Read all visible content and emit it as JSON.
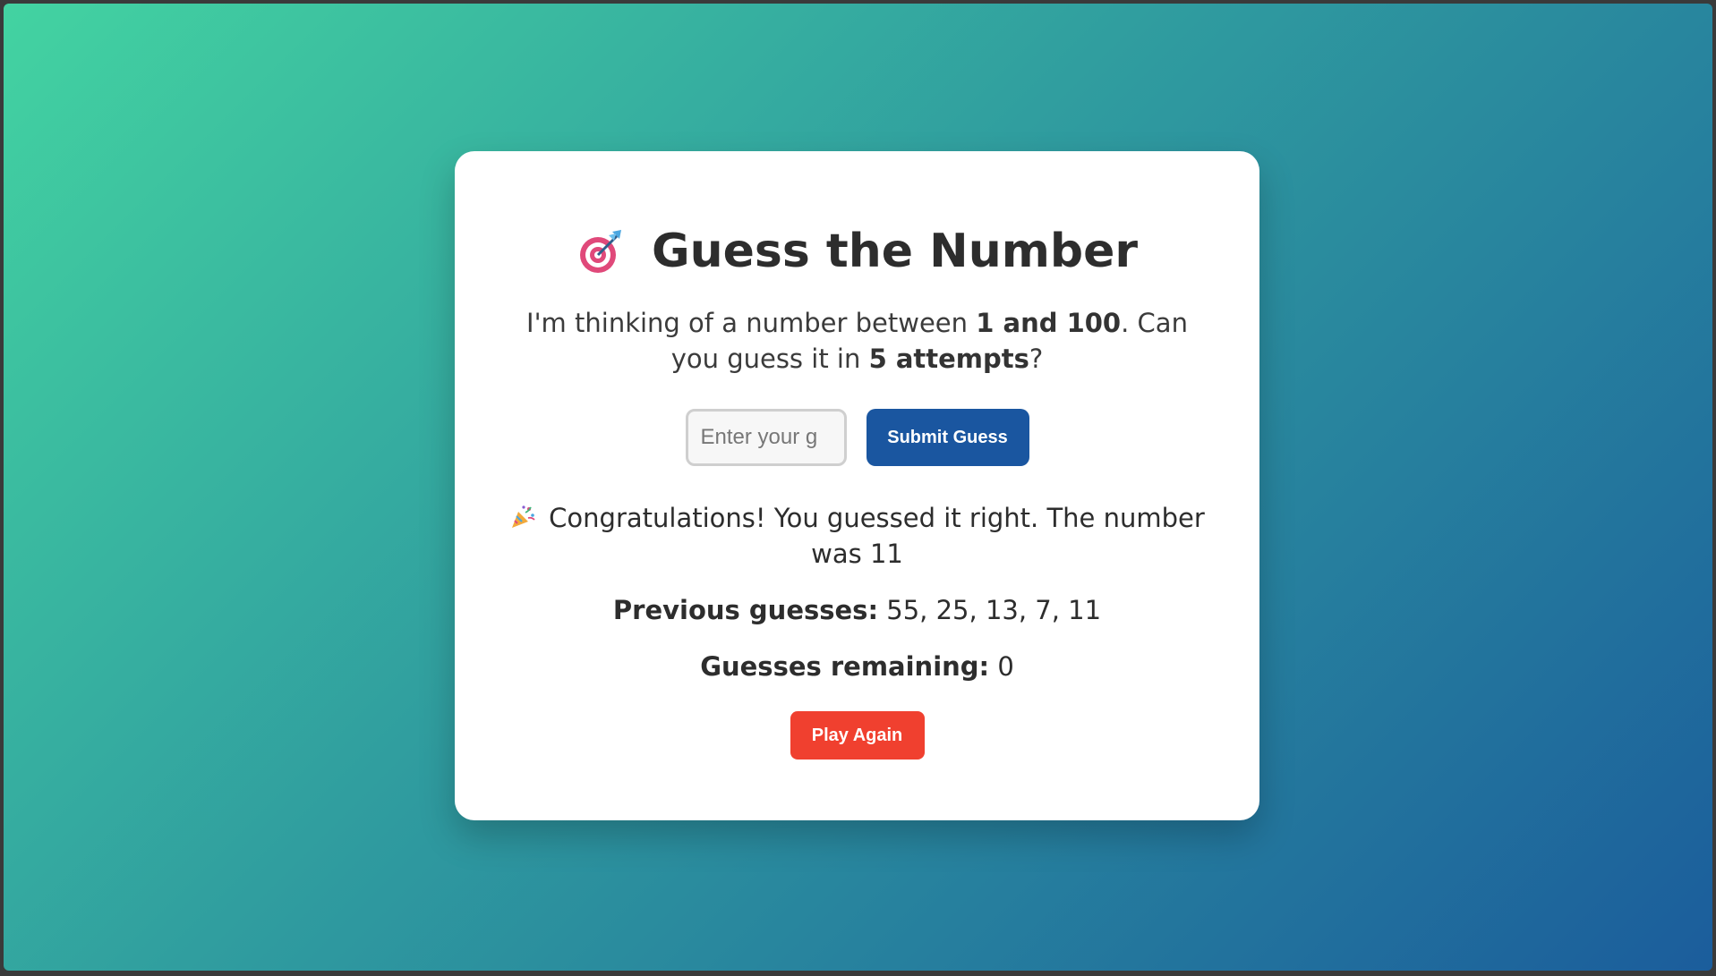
{
  "colors": {
    "background_gradient_start": "#43d3a1",
    "background_gradient_end": "#1b5d9c",
    "card": "#ffffff",
    "submit_button": "#1a56a0",
    "play_again_button": "#f0402f",
    "text": "#2d2d2d"
  },
  "header": {
    "icon": "direct-hit-target-icon",
    "title": "Guess the Number"
  },
  "intro": {
    "part1": "I'm thinking of a number between ",
    "range": "1 and 100",
    "part2": ". Can you guess it in ",
    "attempts": "5 attempts",
    "part3": "?"
  },
  "form": {
    "input_value": "",
    "input_placeholder": "Enter your guess",
    "submit_label": "Submit Guess"
  },
  "result": {
    "icon": "party-popper-icon",
    "message": "Congratulations! You guessed it right. The number was 11"
  },
  "stats": {
    "previous_label": "Previous guesses:",
    "previous_value": "55, 25, 13, 7, 11",
    "remaining_label": "Guesses remaining:",
    "remaining_value": "0"
  },
  "actions": {
    "play_again_label": "Play Again"
  }
}
